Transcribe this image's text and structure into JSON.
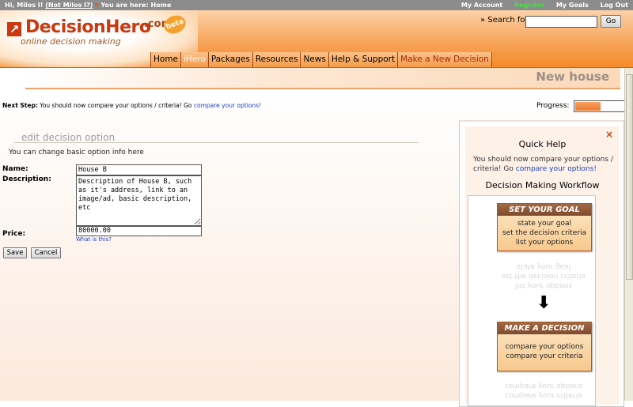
{
  "topbar": {
    "greeting": "Hi, Milos I!",
    "not_user": "(Not Milos I?)",
    "location": "You are here: Home",
    "links": [
      "My Account",
      "Register",
      "My Goals",
      "Log Out"
    ]
  },
  "brand": {
    "name": "DecisionHero",
    "suffix": ".com",
    "badge": "beta",
    "tagline": "online decision making"
  },
  "search": {
    "label": "» Search for:",
    "value": "",
    "button": "Go"
  },
  "nav": {
    "items": [
      "Home",
      "iHero",
      "Packages",
      "Resources",
      "News",
      "Help & Support",
      "Make a New Decision"
    ],
    "active_index": 1
  },
  "page": {
    "title": "New house"
  },
  "next_step": {
    "label": "Next Step:",
    "text": "You should now compare your options / criteria! Go",
    "link": "compare your options!"
  },
  "progress": {
    "label": "Progress:",
    "fraction": 0.52
  },
  "form": {
    "section_title": "edit decision option",
    "subtitle": "You can change basic option info here",
    "name_label": "Name:",
    "name_value": "House B",
    "description_label": "Description:",
    "description_value": "Description of House B, such as it's address, link to an image/ad, basic description, etc",
    "price_label": "Price:",
    "price_value": "80000.00",
    "price_help": "What is this?",
    "save_button": "Save",
    "cancel_button": "Cancel"
  },
  "quick_help": {
    "close": "×",
    "title": "Quick Help",
    "text": "You should now compare your options / criteria! Go",
    "link": "compare your options!",
    "workflow_title": "Decision Making Workflow",
    "steps": [
      {
        "head": "SET YOUR GOAL",
        "lines": [
          "state your goal",
          "set the decision criteria",
          "list your options"
        ]
      },
      {
        "head": "MAKE A DECISION",
        "lines": [
          "compare your options",
          "compare your criteria"
        ]
      }
    ]
  }
}
